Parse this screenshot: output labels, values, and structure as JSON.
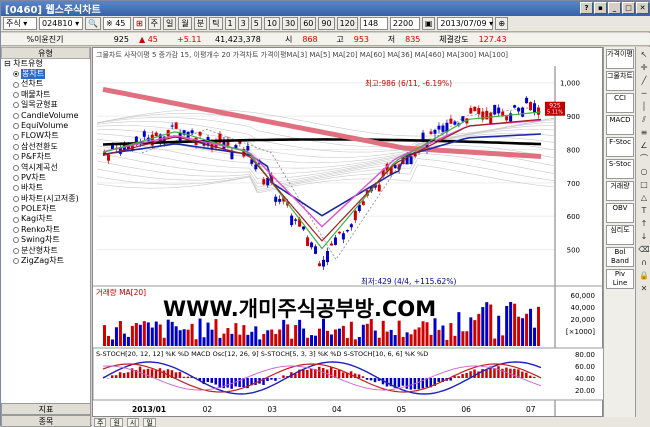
{
  "window": {
    "title": "[0460] 웹스주식차트"
  },
  "toolbar": {
    "market": "주식",
    "code": "024810",
    "name_label": "※ 45",
    "btn_ju": "주",
    "btn_il": "일",
    "btn_wol": "월",
    "btn_bun": "분",
    "btn_tick": "틱",
    "periods": [
      "1",
      "3",
      "5",
      "10",
      "30",
      "60",
      "90",
      "120"
    ],
    "count1": "148",
    "count2": "2200",
    "date": "2013/07/09"
  },
  "quote": {
    "sub_label": "%이윤진기",
    "price": "925",
    "change": "▲ 45",
    "change_pct": "+5.11",
    "volume": "41,423,378",
    "open_label": "시",
    "open": "868",
    "high_label": "고",
    "high": "953",
    "low_label": "저",
    "low": "835",
    "strength_label": "체결강도",
    "strength": "127.43"
  },
  "sidebar": {
    "header": "유형",
    "root": "차트유형",
    "items": [
      "봉차트",
      "선차트",
      "매물차트",
      "일목균형표",
      "CandleVolume",
      "EquiVolume",
      "FLOW차트",
      "삼선전환도",
      "P&F차트",
      "역시계곡선",
      "PV차트",
      "바차트",
      "바차트(시고저종)",
      "POLE차트",
      "Kagi차트",
      "Renko차트",
      "Swing차트",
      "분산형차트",
      "ZigZag차트"
    ],
    "selected_index": 0,
    "bottom_tabs": [
      "지표",
      "종목"
    ]
  },
  "chart": {
    "legend_text": "그물차트 사작이평 5 증가감 15, 이평개수 20  가격차트  가격이평MA[3]  MA[5]  MA[20]  MA[60]  MA[36]  MA[460]  MA[300]  MA[100]",
    "high_note": "최고:986 (6/11, -6.19%)",
    "low_note": "최저:429 (4/4, +115.62%)",
    "y_labels": [
      "1,000",
      "900",
      "800",
      "700",
      "600",
      "500"
    ],
    "y_values": [
      1000,
      900,
      800,
      700,
      600,
      500
    ],
    "price_min": 400,
    "price_max": 1050,
    "last_price_box": "925",
    "last_price_box2": "5.11%",
    "volume_label": "거래량 MA[20]",
    "volume_axis": [
      "60,000",
      "40,000",
      "20,000",
      "[×1000]"
    ],
    "watermark": "WWW.개미주식공부방.COM",
    "stoch_label": "S-STOCH[20, 12, 12] %K %D MACD Osc[12, 26, 9] S-STOCH[5, 3, 3] %K %D S-STOCH[10, 6, 6] %K %D",
    "stoch_axis": [
      "80.00",
      "60.00",
      "40.00",
      "20.00"
    ],
    "x_labels": [
      "2013/01",
      "02",
      "03",
      "04",
      "05",
      "06",
      "07"
    ],
    "colors": {
      "up": "#d00000",
      "down": "#0000c8",
      "ma_black": "#000000",
      "ma_pink": "#e07080",
      "ma_blue": "#1a2aa0",
      "ma_magenta": "#e050d0",
      "ma_green": "#40b040",
      "ma_brown": "#a02020"
    }
  },
  "chart_data": {
    "type": "line",
    "title": "",
    "xlabel": "",
    "ylabel": "",
    "x": [
      "2013/01",
      "02",
      "03",
      "04",
      "05",
      "06",
      "07"
    ],
    "ylim": [
      400,
      1050
    ],
    "series": [
      {
        "name": "가격",
        "values": [
          790,
          860,
          790,
          470,
          760,
          900,
          925
        ]
      }
    ]
  },
  "right_panel": [
    "가격이평",
    "그물차트",
    "CCI",
    "MACD",
    "F-Stoc",
    "S-Stoc",
    "거래량",
    "OBV",
    "심리도",
    "Bol Band",
    "Piv Line"
  ],
  "footer": {
    "tabs": [
      "주",
      "원",
      "시",
      "일"
    ]
  }
}
